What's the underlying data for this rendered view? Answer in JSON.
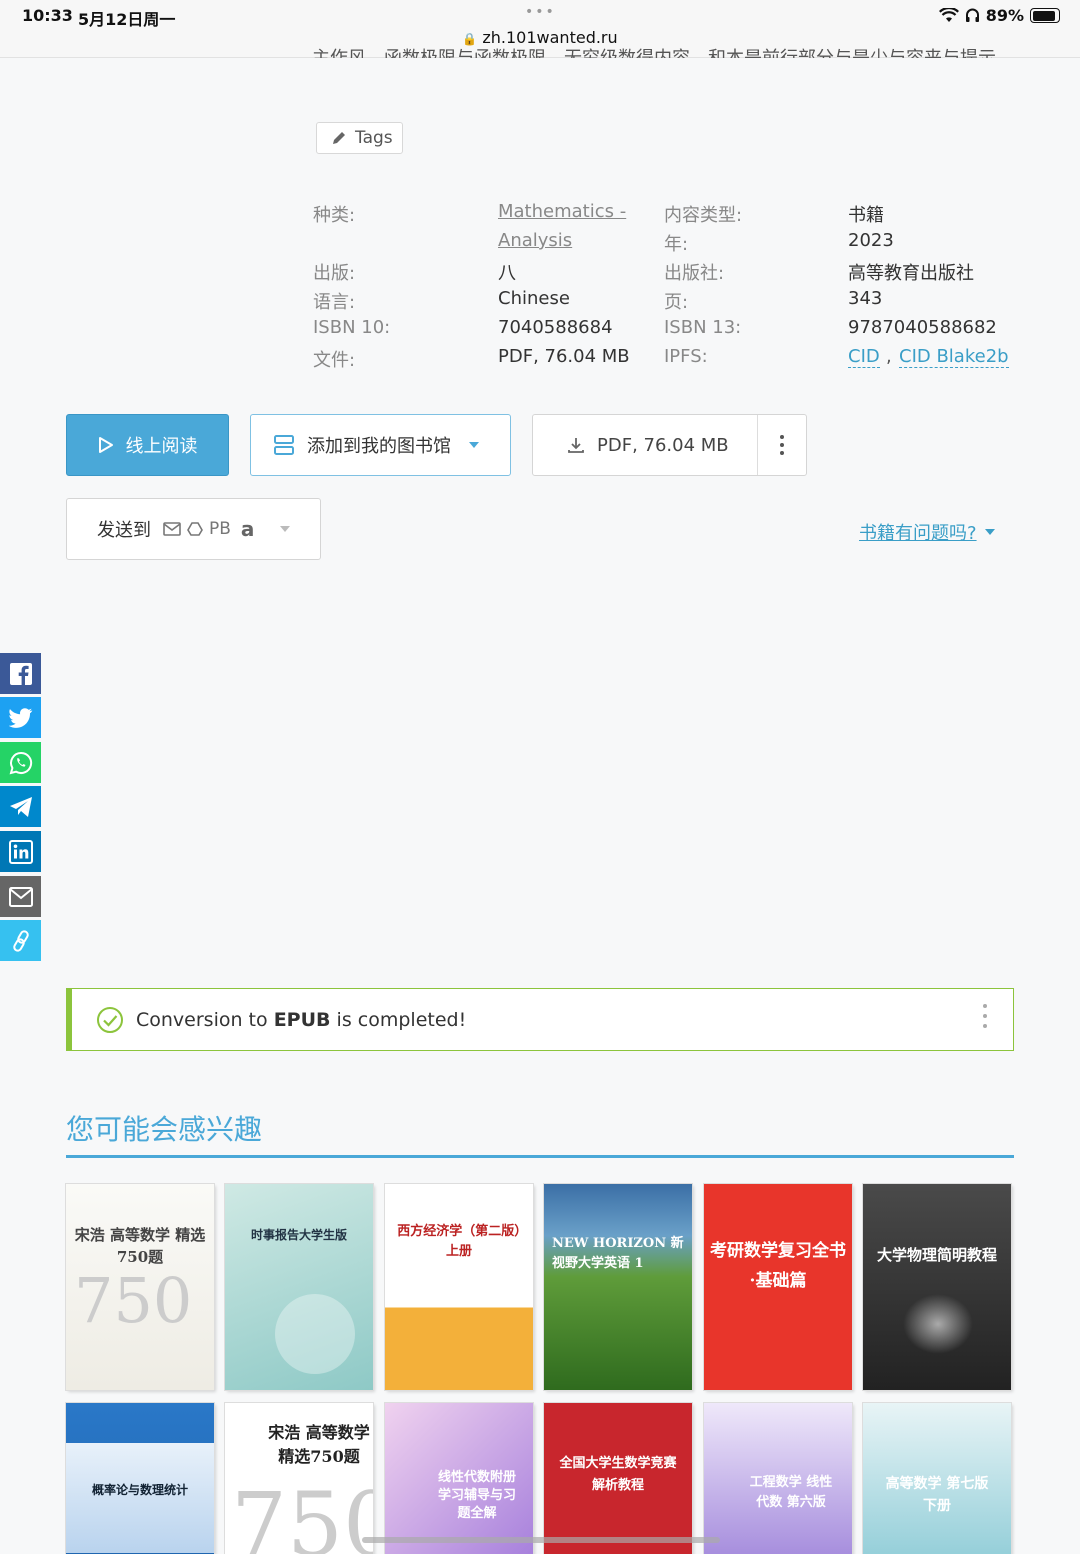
{
  "status_bar": {
    "time": "10:33",
    "date": "5月12日周一",
    "url": "zh.101wanted.ru",
    "battery": "89%",
    "battery_level": 0.89
  },
  "partial_text": "主作风、函数极限与函数极限、无穷级数得内容，和本是前行部分与是少与容来与提示。",
  "tags_label": "Tags",
  "properties": {
    "category_label": "种类:",
    "category_value": "Mathematics - Analysis",
    "category_line1": "Mathematics -",
    "category_line2": "Analysis",
    "content_type_label": "内容类型:",
    "content_type_value": "书籍",
    "year_label": "年:",
    "year_value": "2023",
    "edition_label": "出版:",
    "edition_value": "八",
    "publisher_label": "出版社:",
    "publisher_value": "高等教育出版社",
    "language_label": "语言:",
    "language_value": "Chinese",
    "pages_label": "页:",
    "pages_value": "343",
    "isbn10_label": "ISBN 10:",
    "isbn10_value": "7040588684",
    "isbn13_label": "ISBN 13:",
    "isbn13_value": "9787040588682",
    "file_label": "文件:",
    "file_value": "PDF, 76.04 MB",
    "ipfs_label": "IPFS:",
    "ipfs_cid": "CID",
    "ipfs_sep": ",",
    "ipfs_blake": "CID Blake2b"
  },
  "buttons": {
    "read_online": "线上阅读",
    "add_to_library": "添加到我的图书馆",
    "download": "PDF, 76.04 MB",
    "send_to": "发送到",
    "send_pb": "PB",
    "problem": "书籍有问题吗?"
  },
  "share_icons": [
    "facebook-icon",
    "twitter-icon",
    "whatsapp-icon",
    "telegram-icon",
    "linkedin-icon",
    "email-icon",
    "link-icon"
  ],
  "notice": {
    "prefix": "Conversion to ",
    "format": "EPUB",
    "suffix": " is completed!"
  },
  "recommend_title": "您可能会感兴趣",
  "covers": [
    {
      "title": "宋浩 高等数学 精选750题"
    },
    {
      "title": "时事报告大学生版"
    },
    {
      "title": "西方经济学（第二版）上册"
    },
    {
      "title": "NEW HORIZON 新视野大学英语 1"
    },
    {
      "title": "考研数学复习全书·基础篇"
    },
    {
      "title": "大学物理简明教程"
    },
    {
      "title": "概率论与数理统计"
    },
    {
      "title": "宋浩 高等数学 精选750题"
    },
    {
      "title": "线性代数附册 学习辅导与习题全解"
    },
    {
      "title": "全国大学生数学竞赛解析教程"
    },
    {
      "title": "工程数学 线性代数 第六版"
    },
    {
      "title": "高等数学 第七版 下册"
    }
  ],
  "colors": {
    "accent": "#4aa8d8",
    "success": "#8cc43c",
    "facebook": "#3b5998",
    "twitter": "#1da1f2",
    "whatsapp": "#25d366",
    "telegram": "#0088cc",
    "linkedin": "#0077b5",
    "email": "#666666",
    "link": "#36c1f0"
  }
}
